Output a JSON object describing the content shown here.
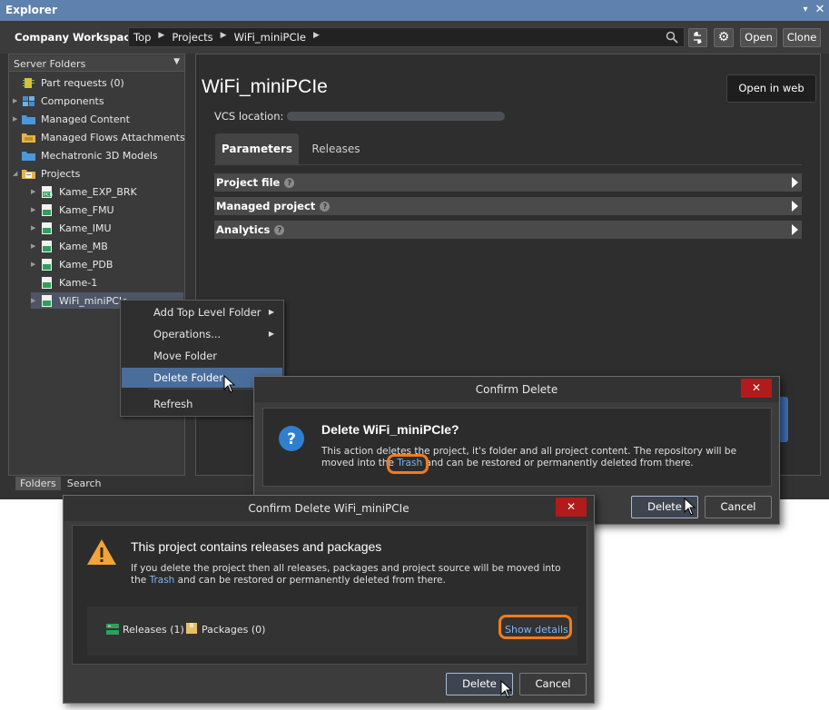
{
  "explorer": {
    "title": "Explorer",
    "pin_glyph": "▾",
    "close_glyph": "✕"
  },
  "toolbar": {
    "workspace": "Company Workspace",
    "breadcrumbs": [
      "Top",
      "Projects",
      "WiFi_miniPCIe"
    ],
    "open_label": "Open",
    "clone_label": "Clone"
  },
  "left_panel": {
    "header": "Server Folders",
    "items": [
      {
        "label": "Part requests (0)",
        "icon": "part-request-icon"
      },
      {
        "label": "Components",
        "icon": "components-icon"
      },
      {
        "label": "Managed Content",
        "icon": "folder-icon"
      },
      {
        "label": "Managed Flows Attachments",
        "icon": "folder-icon"
      },
      {
        "label": "Mechatronic 3D Models",
        "icon": "folder-icon"
      },
      {
        "label": "Projects",
        "icon": "projects-folder-icon"
      },
      {
        "label": "Kame_EXP_BRK",
        "icon": "project-icon"
      },
      {
        "label": "Kame_FMU",
        "icon": "project-icon"
      },
      {
        "label": "Kame_IMU",
        "icon": "project-icon"
      },
      {
        "label": "Kame_MB",
        "icon": "project-icon"
      },
      {
        "label": "Kame_PDB",
        "icon": "project-icon"
      },
      {
        "label": "Kame-1",
        "icon": "project-icon"
      },
      {
        "label": "WiFi_miniPCIe",
        "icon": "project-icon"
      }
    ],
    "tabs": [
      "Folders",
      "Search"
    ]
  },
  "right_panel": {
    "project_title": "WiFi_miniPCIe",
    "open_in_web": "Open in web",
    "vcs_label": "VCS location:",
    "tabs": [
      "Parameters",
      "Releases"
    ],
    "sections": [
      "Project file",
      "Managed project",
      "Analytics"
    ]
  },
  "context_menu": {
    "items": [
      "Add Top Level Folder",
      "Operations...",
      "Move Folder",
      "Delete Folder",
      "Refresh"
    ]
  },
  "confirm_delete": {
    "title": "Confirm Delete",
    "close_glyph": "✕",
    "heading": "Delete WiFi_miniPCIe?",
    "message_1": "This action deletes the project, it's folder and all project content. The repository will be",
    "message_2a": "moved into the ",
    "message_link": "Trash",
    "message_2b": " and can be restored or permanently deleted from there.",
    "delete_label": "Delete",
    "cancel_label": "Cancel"
  },
  "confirm_delete_project": {
    "title": "Confirm Delete WiFi_miniPCIe",
    "close_glyph": "✕",
    "heading": "This project contains releases and packages",
    "message_1": "If you delete the project then all releases, packages and project source will be moved into",
    "message_2a": "the ",
    "message_link": "Trash",
    "message_2b": " and can be restored or permanently deleted from there.",
    "releases_label": "Releases (1)",
    "packages_label": "Packages (0)",
    "show_details": "Show details",
    "delete_label": "Delete",
    "cancel_label": "Cancel"
  },
  "colors": {
    "titlebar": "#5e82ad",
    "menu_hover": "#4a6e9c",
    "close_red": "#b11b1b",
    "highlight_orange": "#f07c1f",
    "link_blue": "#7fb6f0"
  }
}
